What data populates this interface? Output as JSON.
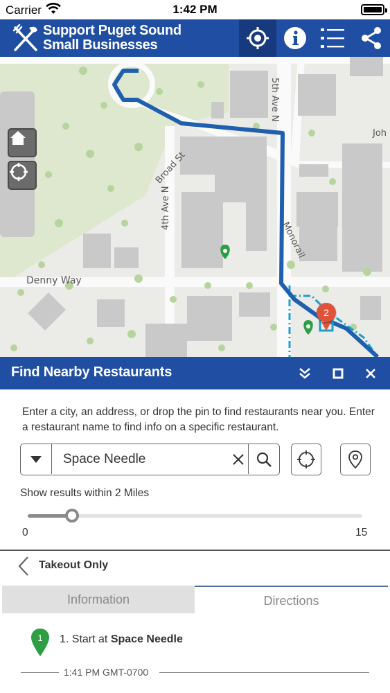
{
  "status_bar": {
    "carrier": "Carrier",
    "time": "1:42 PM"
  },
  "header": {
    "title_line1": "Support Puget Sound",
    "title_line2": "Small Businesses",
    "icons": [
      "utensils-icon",
      "locate-icon",
      "info-icon",
      "list-icon",
      "share-icon"
    ]
  },
  "map": {
    "street_labels": {
      "broad": "Broad St",
      "fifth": "5th Ave N",
      "john": "Joh",
      "fourth": "4th Ave N",
      "monorail": "Monorail",
      "denny": "Denny Way"
    },
    "route_marker": "2"
  },
  "panel": {
    "title": "Find Nearby Restaurants",
    "description": "Enter a city, an address, or drop the pin to find restaurants near you.  Enter a restaurant name to find info on a specific restaurant.",
    "search_value": "Space Needle",
    "radius_label": "Show results within 2 Miles",
    "slider": {
      "min": "0",
      "max": "15",
      "value": 2
    },
    "back_label": "Takeout Only",
    "tabs": {
      "information": "Information",
      "directions": "Directions"
    },
    "step": {
      "marker": "1",
      "prefix": "1. Start at ",
      "place": "Space Needle"
    },
    "timestamp": "1:41 PM GMT-0700"
  },
  "colors": {
    "brand_blue": "#1f4ea3",
    "route_blue": "#1f5fae",
    "pin_green": "#2e9e45",
    "marker_red": "#e0533b"
  }
}
